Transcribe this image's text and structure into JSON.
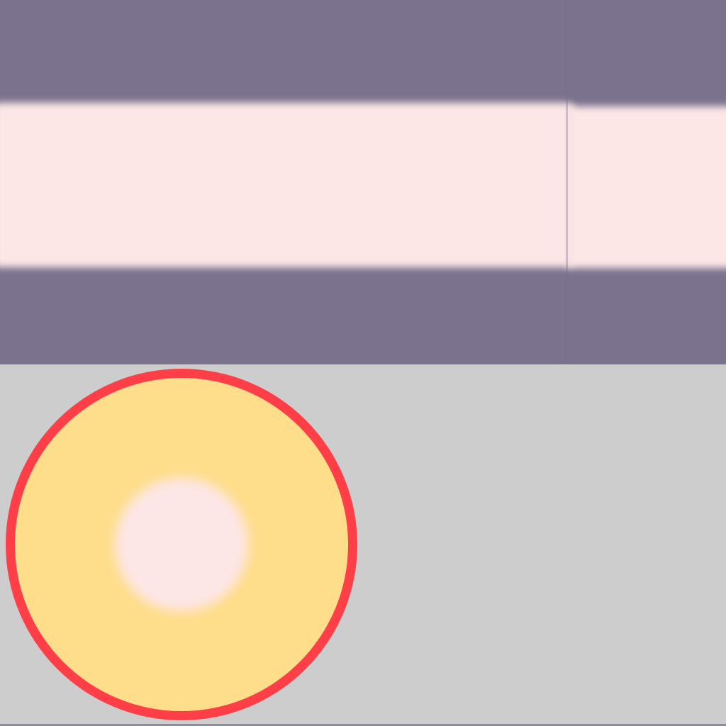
{
  "colors": {
    "top_background": "#7b738d",
    "band": "#fce6e6",
    "bottom_background": "#cdcdcd",
    "disc_ring": "#ff3f48",
    "disc_fill": "#fede8a",
    "disc_core": "#fde6e6"
  }
}
